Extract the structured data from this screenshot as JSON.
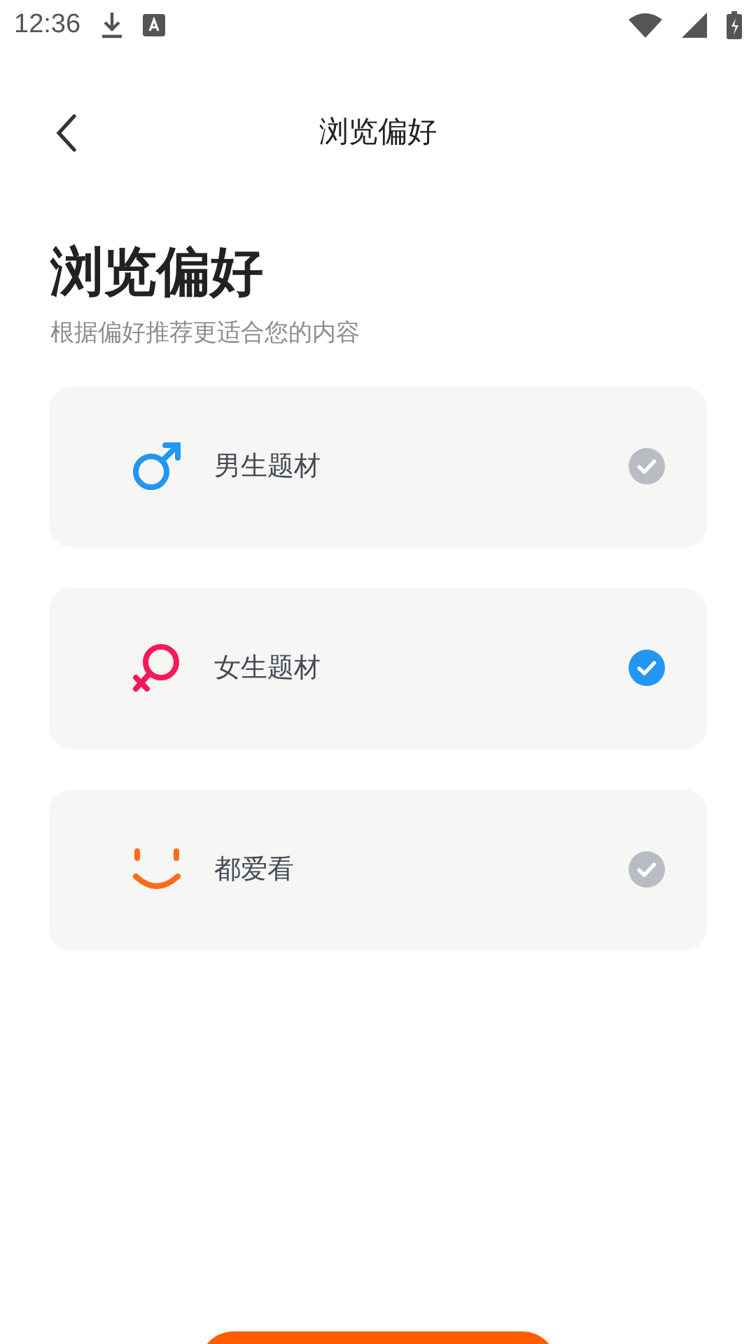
{
  "status_bar": {
    "time": "12:36"
  },
  "header": {
    "title": "浏览偏好"
  },
  "heading": "浏览偏好",
  "subtitle": "根据偏好推荐更适合您的内容",
  "options": [
    {
      "kind": "male",
      "label": "男生题材",
      "selected": false
    },
    {
      "kind": "female",
      "label": "女生题材",
      "selected": true
    },
    {
      "kind": "both",
      "label": "都爱看",
      "selected": false
    }
  ]
}
